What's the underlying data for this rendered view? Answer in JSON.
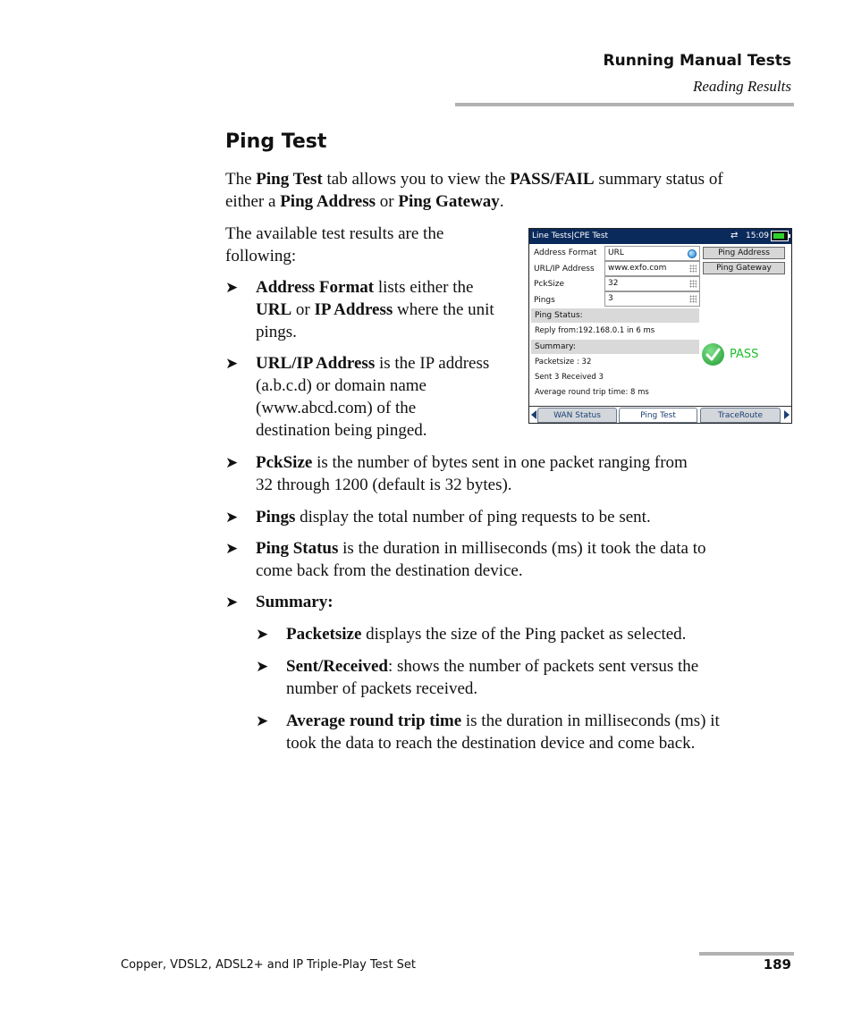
{
  "header": {
    "chapter": "Running Manual Tests",
    "section": "Reading Results"
  },
  "title": "Ping Test",
  "intro": {
    "t1": "The ",
    "b1": "Ping Test",
    "t2": " tab allows you to view the ",
    "b2": "PASS/FAIL",
    "t3": " summary status of",
    "t4": "either a ",
    "b3": "Ping Address",
    "t5": " or ",
    "b4": "Ping Gateway",
    "t6": "."
  },
  "available": {
    "line1": "The available test results are the",
    "line2": "following:"
  },
  "bullet_glyph": "➤",
  "bullets": [
    {
      "bold": "Address Format",
      "lines": [
        " lists either the",
        "",
        "pings."
      ],
      "l2_b1": "URL",
      "l2_t1": " or ",
      "l2_b2": "IP Address",
      "l2_t2": " where the unit"
    },
    {
      "bold": "URL/IP Address",
      "l1": " is the IP address",
      "l2": "(a.b.c.d) or domain name",
      "l3": "(www.abcd.com) of the",
      "l4": "destination being pinged."
    },
    {
      "bold": "PckSize",
      "l1": " is the number of bytes sent in one packet ranging from",
      "l2": "32 through 1200 (default is 32 bytes)."
    },
    {
      "bold": "Pings",
      "l1": " display the total number of ping requests to be sent."
    },
    {
      "bold": "Ping Status",
      "l1": " is the duration in milliseconds (ms) it took the data to",
      "l2": "come back from the destination device."
    },
    {
      "bold": "Summary:"
    }
  ],
  "subbullets": [
    {
      "bold": "Packetsize",
      "l1": " displays the size of the Ping packet as selected."
    },
    {
      "bold": "Sent/Received",
      "l1": ": shows the number of packets sent versus the",
      "l2": "number of packets received."
    },
    {
      "bold": "Average round trip time",
      "l1": " is the duration in milliseconds (ms) it",
      "l2": "took the data to reach the destination device and come back."
    }
  ],
  "device": {
    "title": "Line Tests|CPE Test",
    "time": "15:09",
    "fields": [
      {
        "label": "Address Format",
        "value": "URL",
        "icon": "globe-icon"
      },
      {
        "label": "URL/IP Address",
        "value": "www.exfo.com",
        "icon": "keypad-icon"
      },
      {
        "label": "PckSize",
        "value": "32",
        "icon": "keypad-icon"
      },
      {
        "label": "Pings",
        "value": "3",
        "icon": "keypad-icon"
      }
    ],
    "buttons": {
      "ping_address": "Ping Address",
      "ping_gateway": "Ping Gateway"
    },
    "ping_status_label": "Ping Status:",
    "reply": "Reply from:192.168.0.1 in  6  ms",
    "summary_label": "Summary:",
    "packetsize": "Packetsize : 32",
    "sent_received": "Sent  3 Received  3",
    "avg_rtt": "Average round trip time: 8  ms",
    "result": "PASS",
    "result_color": "#1cbf2c",
    "tabs": [
      {
        "label": "WAN Status",
        "active": false
      },
      {
        "label": "Ping Test",
        "active": true
      },
      {
        "label": "TraceRoute",
        "active": false
      }
    ]
  },
  "footer": {
    "product": "Copper, VDSL2, ADSL2+ and IP Triple-Play Test Set",
    "page": "189"
  }
}
